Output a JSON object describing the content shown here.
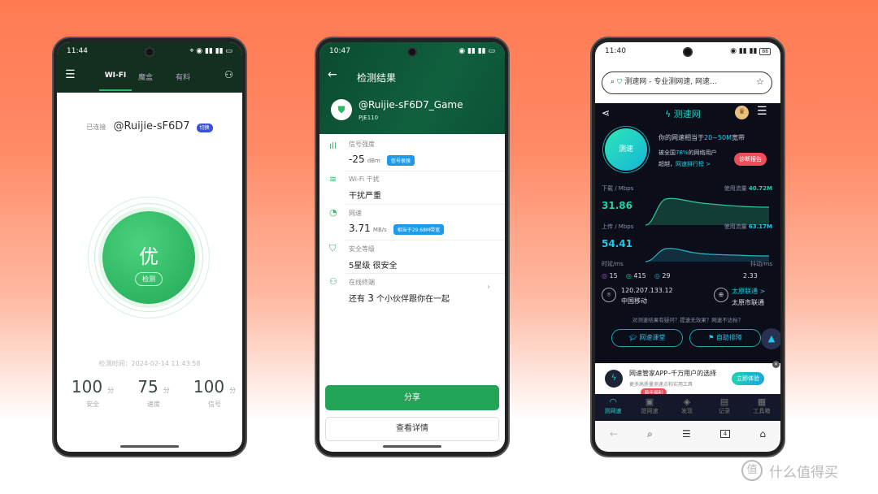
{
  "phone1": {
    "status": {
      "time": "11:44"
    },
    "tabs": [
      {
        "label": "WI-FI",
        "active": true
      },
      {
        "label": "魔盒"
      },
      {
        "label": "有料"
      }
    ],
    "connected_label": "已连接",
    "ssid": "@Ruijie-sF6D7",
    "switch_label": "切换",
    "grade": "优",
    "detect_label": "检测",
    "check_time": "检测时间：2024-02-14 11:43:58",
    "scores": [
      {
        "value": "100",
        "unit": "分",
        "label": "安全"
      },
      {
        "value": "75",
        "unit": "分",
        "label": "速度"
      },
      {
        "value": "100",
        "unit": "分",
        "label": "信号"
      }
    ],
    "accent": "#2db866"
  },
  "phone2": {
    "status": {
      "time": "10:47"
    },
    "title": "检测结果",
    "ssid": "@Ruijie-sF6D7_Game",
    "device": "PJE110",
    "items": [
      {
        "icon": "signal-icon",
        "label": "信号强度",
        "value": "-25",
        "unit": "dBm",
        "tag": "信号很强"
      },
      {
        "icon": "interference-icon",
        "label": "Wi-Fi 干扰",
        "value": "干扰严重"
      },
      {
        "icon": "speedometer-icon",
        "label": "网速",
        "value": "3.71",
        "unit": "MB/s",
        "tag": "相当于29.68M带宽"
      },
      {
        "icon": "shield-icon",
        "label": "安全等级",
        "value": "5星级 很安全"
      },
      {
        "icon": "users-icon",
        "label": "在线终端",
        "value_pre": "还有",
        "value_num": "3",
        "value_post": "个小伙伴跟你在一起"
      }
    ],
    "share_label": "分享",
    "details_label": "查看详情",
    "accent": "#0f6b43"
  },
  "phone3": {
    "status": {
      "time": "11:40",
      "battery": "88"
    },
    "url": "测速网 - 专业测网速, 网速...",
    "brand": "测速网",
    "test_label": "测速",
    "line1_pre": "你的网速相当于",
    "line1_hl": "20~50M",
    "line1_post": "宽带",
    "line2_pre": "被全国",
    "line2_hl": "78%",
    "line2_post": "的网络用户",
    "line3_pre": "超越，",
    "line3_link": "网速排行榜 >",
    "report_label": "诊断报告",
    "download": {
      "label": "下载 / Mbps",
      "value": "31.86",
      "usage_label": "使用流量",
      "usage": "40.72M"
    },
    "upload": {
      "label": "上传 / Mbps",
      "value": "54.41",
      "usage_label": "使用流量",
      "usage": "63.17M"
    },
    "latency_label": "时延/ms",
    "jitter_label": "抖动/ms",
    "latency": [
      "15",
      "415",
      "29"
    ],
    "jitter": "2.33",
    "ip": "120.207.133.12",
    "isp": "中国移动",
    "server_link": "太原联通 >",
    "server": "太原市联通",
    "question": "对测速结果有疑问？提速无效果？网速不达标？",
    "btn1": "网速课堂",
    "btn2": "自助排障",
    "ad_title": "网速管家APP–千万用户的选择",
    "ad_sub": "更多高质量测速点和实用工具",
    "ad_btn": "立即体验",
    "promo": "新年福利",
    "nav": [
      "测网速",
      "提网速",
      "发现",
      "记录",
      "工具箱"
    ],
    "tab_count": "4",
    "accent": "#1ed3c4"
  },
  "watermark": {
    "logo": "值",
    "text": "什么值得买"
  }
}
